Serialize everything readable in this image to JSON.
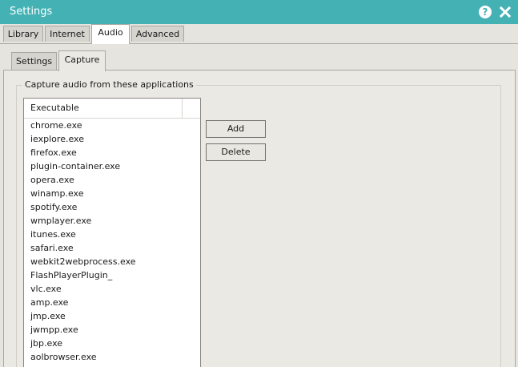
{
  "window": {
    "title": "Settings",
    "help_label": "?",
    "colors": {
      "titlebar": "#44b2b4",
      "background": "#e6e4de"
    }
  },
  "main_tabs": [
    {
      "label": "Library",
      "active": false
    },
    {
      "label": "Internet",
      "active": false
    },
    {
      "label": "Audio",
      "active": true
    },
    {
      "label": "Advanced",
      "active": false
    }
  ],
  "sub_tabs": [
    {
      "label": "Settings",
      "active": false
    },
    {
      "label": "Capture",
      "active": true
    }
  ],
  "capture": {
    "group_label": "Capture audio from these applications",
    "list": {
      "column_header": "Executable",
      "items": [
        "chrome.exe",
        "iexplore.exe",
        "firefox.exe",
        "plugin-container.exe",
        "opera.exe",
        "winamp.exe",
        "spotify.exe",
        "wmplayer.exe",
        "itunes.exe",
        "safari.exe",
        "webkit2webprocess.exe",
        "FlashPlayerPlugin_",
        "vlc.exe",
        "amp.exe",
        "jmp.exe",
        "jwmpp.exe",
        "jbp.exe",
        "aolbrowser.exe"
      ]
    },
    "buttons": {
      "add_label": "Add",
      "delete_label": "Delete"
    }
  }
}
